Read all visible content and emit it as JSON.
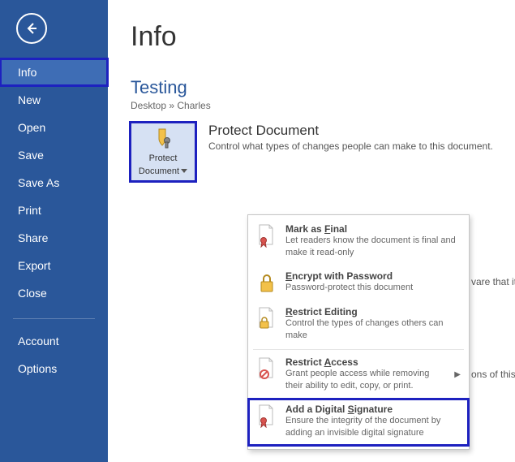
{
  "sidebar": {
    "items": [
      {
        "label": "Info",
        "selected": true
      },
      {
        "label": "New"
      },
      {
        "label": "Open"
      },
      {
        "label": "Save"
      },
      {
        "label": "Save As"
      },
      {
        "label": "Print"
      },
      {
        "label": "Share"
      },
      {
        "label": "Export"
      },
      {
        "label": "Close"
      }
    ],
    "footer": [
      {
        "label": "Account"
      },
      {
        "label": "Options"
      }
    ]
  },
  "page": {
    "title": "Info",
    "doc_title": "Testing",
    "breadcrumb": "Desktop » Charles"
  },
  "protect": {
    "button_line1": "Protect",
    "button_line2": "Document",
    "heading": "Protect Document",
    "desc": "Control what types of changes people can make to this document."
  },
  "behind": {
    "frag1": "vare that it contains:",
    "frag2": "ons of this file."
  },
  "menu": {
    "items": [
      {
        "title_pre": "Mark as ",
        "title_u": "F",
        "title_post": "inal",
        "desc": "Let readers know the document is final and make it read-only",
        "icon": "page-ribbon-icon"
      },
      {
        "title_pre": "",
        "title_u": "E",
        "title_post": "ncrypt with Password",
        "desc": "Password-protect this document",
        "icon": "lock-icon"
      },
      {
        "title_pre": "",
        "title_u": "R",
        "title_post": "estrict Editing",
        "desc": "Control the types of changes others can make",
        "icon": "page-lock-icon"
      },
      {
        "title_pre": "Restrict ",
        "title_u": "A",
        "title_post": "ccess",
        "desc": "Grant people access while removing their ability to edit, copy, or print.",
        "icon": "page-block-icon",
        "submenu": true
      },
      {
        "title_pre": "Add a Digital ",
        "title_u": "S",
        "title_post": "ignature",
        "desc": "Ensure the integrity of the document by adding an invisible digital signature",
        "icon": "page-ribbon-icon",
        "hl": true
      }
    ]
  }
}
